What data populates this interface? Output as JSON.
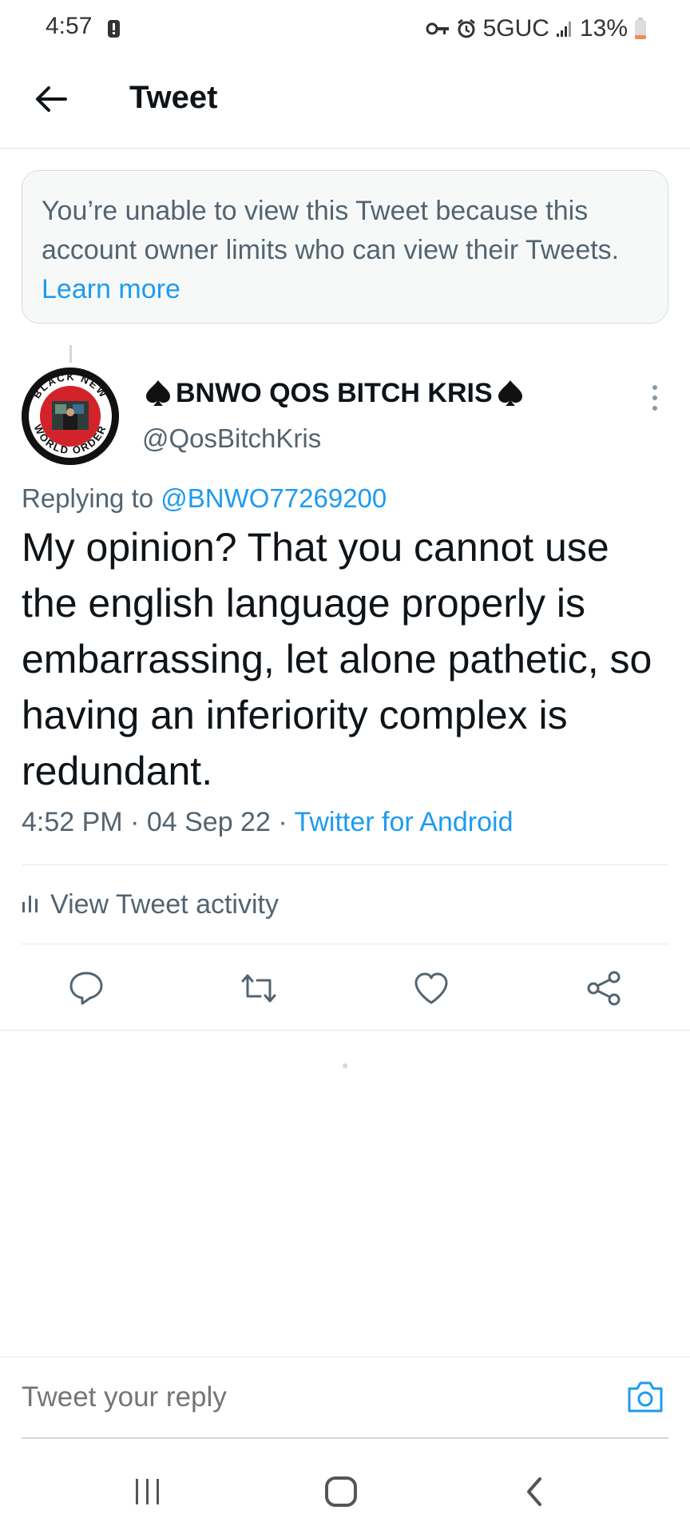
{
  "status_bar": {
    "time": "4:57",
    "network": "5GUC",
    "battery": "13%"
  },
  "header": {
    "title": "Tweet"
  },
  "notice": {
    "text": "You’re unable to view this Tweet because this account owner limits who can view their Tweets. ",
    "link": "Learn more"
  },
  "tweet": {
    "display_name": "BNWO QOS BITCH KRIS",
    "handle": "@QosBitchKris",
    "replying_prefix": "Replying to ",
    "replying_to": "@BNWO77269200",
    "text": "My opinion? That you cannot use the english language properly is embarrassing, let alone pathetic, so having an inferiority complex is redundant.",
    "time": "4:52 PM",
    "separator": " · ",
    "date": "04 Sep 22",
    "source": "Twitter for Android",
    "avatar_text": {
      "top": "BLACK NEW",
      "bottom": "WORLD ORDER"
    }
  },
  "activity": {
    "label": "View Tweet activity"
  },
  "reply_bar": {
    "placeholder": "Tweet your reply"
  },
  "colors": {
    "accent": "#1d9bf0",
    "secondary_text": "#536471"
  }
}
